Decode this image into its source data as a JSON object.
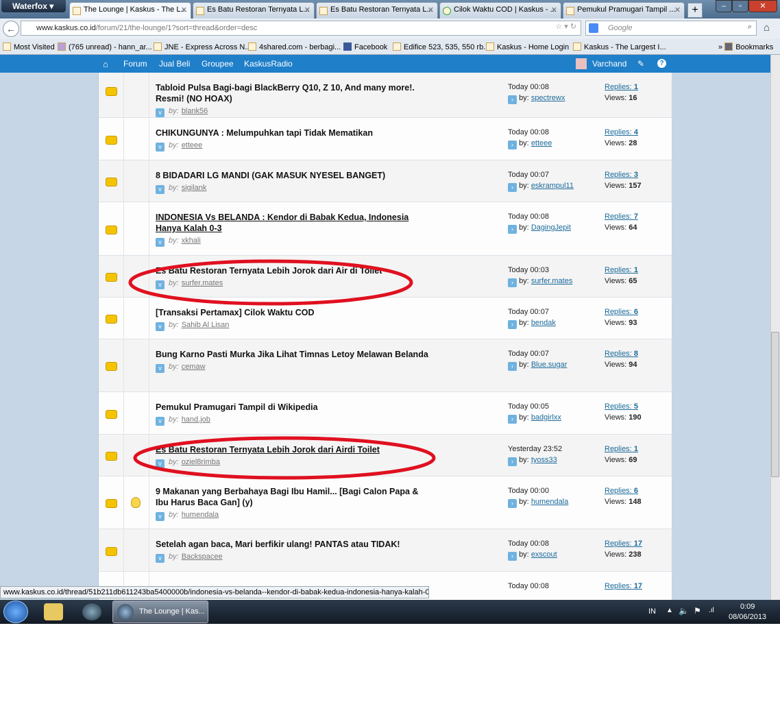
{
  "browser": {
    "app_button": "Waterfox",
    "tabs": [
      {
        "label": "The Lounge | Kaskus - The L...",
        "active": true
      },
      {
        "label": "Es Batu Restoran Ternyata L..."
      },
      {
        "label": "Es Batu Restoran Ternyata L..."
      },
      {
        "label": "Cilok Waktu COD | Kaskus - ..."
      },
      {
        "label": "Pemukul Pramugari Tampil ..."
      }
    ],
    "new_tab": "+",
    "url_domain": "www.kaskus.co.id",
    "url_path": "/forum/21/the-lounge/1?sort=thread&order=desc",
    "search_placeholder": "Google",
    "bookmarks": [
      "Most Visited",
      "(765 unread) - hann_ar...",
      "JNE - Express Across N...",
      "4shared.com - berbagi...",
      "Facebook",
      "Edifice 523, 535, 550 rb...",
      "Kaskus - Home Login",
      "Kaskus - The Largest I..."
    ],
    "bookmarks_menu": "Bookmarks",
    "status_url": "www.kaskus.co.id/thread/51b211db611243ba5400000b/indonesia-vs-belanda--kendor-di-babak-kedua-indonesia-hanya-kalah-0-3/"
  },
  "site_nav": {
    "items": [
      "Forum",
      "Jual Beli",
      "Groupee",
      "KaskusRadio"
    ],
    "user": "Varchand",
    "brand_color": "#1f7fc9"
  },
  "labels": {
    "by": "by:",
    "replies": "Replies:",
    "views": "Views:"
  },
  "threads": [
    {
      "title": "Tabloid Pulsa Bagi-bagi BlackBerry Q10, Z 10, And many more!. Resmi! (NO HOAX)",
      "author": "blank56",
      "time": "Today 00:08",
      "last_by": "spectrewx",
      "replies": "1",
      "views": "16"
    },
    {
      "title": "CHIKUNGUNYA : Melumpuhkan tapi Tidak Mematikan",
      "author": "etteee",
      "time": "Today 00:08",
      "last_by": "etteee",
      "replies": "4",
      "views": "28"
    },
    {
      "title": "8 BIDADARI LG MANDI (GAK MASUK NYESEL BANGET)",
      "author": "sigilank",
      "time": "Today 00:07",
      "last_by": "eskrampul11",
      "replies": "3",
      "views": "157"
    },
    {
      "title": "INDONESIA Vs BELANDA : Kendor di Babak Kedua, Indonesia Hanya Kalah 0-3",
      "author": "xkhali",
      "time": "Today 00:08",
      "last_by": "DagingJepit",
      "replies": "7",
      "views": "64",
      "hover": true
    },
    {
      "title": "Es Batu Restoran Ternyata Lebih Jorok dari Air di Toilet",
      "author": "surfer.mates",
      "time": "Today 00:03",
      "last_by": "surfer.mates",
      "replies": "1",
      "views": "65",
      "circled": true
    },
    {
      "title": "[Transaksi Pertamax] Cilok Waktu COD",
      "author": "Sahib Al Lisan",
      "time": "Today 00:07",
      "last_by": "bendak",
      "replies": "6",
      "views": "93"
    },
    {
      "title": "Bung Karno Pasti Murka Jika Lihat Timnas Letoy Melawan Belanda",
      "author": "cemaw",
      "time": "Today 00:07",
      "last_by": "Blue.sugar",
      "replies": "8",
      "views": "94"
    },
    {
      "title": "Pemukul Pramugari Tampil di Wikipedia",
      "author": "hand.job",
      "time": "Today 00:05",
      "last_by": "badgirlxx",
      "replies": "5",
      "views": "190"
    },
    {
      "title": "Es Batu Restoran Ternyata Lebih Jorok dari Airdi Toilet",
      "author": "oziel8rimba",
      "time": "Yesterday 23:52",
      "last_by": "tyoss33",
      "replies": "1",
      "views": "69",
      "circled": true,
      "hover": true
    },
    {
      "title": "9 Makanan yang Berbahaya Bagi Ibu Hamil... [Bagi Calon Papa & Ibu Harus Baca Gan] (y)",
      "author": "humendala",
      "time": "Today 00:00",
      "last_by": "humendala",
      "replies": "6",
      "views": "148",
      "bulb": true
    },
    {
      "title": "Setelah agan baca, Mari berfikir ulang! PANTAS atau TIDAK!",
      "author": "Backspacee",
      "time": "Today 00:08",
      "last_by": "exscout",
      "replies": "17",
      "views": "238"
    },
    {
      "title": "",
      "author": "",
      "time": "Today 00:08",
      "last_by": "",
      "replies": "17",
      "views": ""
    }
  ],
  "annotation_color": "#e01020",
  "taskbar": {
    "task": "The Lounge | Kas...",
    "lang": "IN",
    "time": "0:09",
    "date": "08/06/2013"
  }
}
